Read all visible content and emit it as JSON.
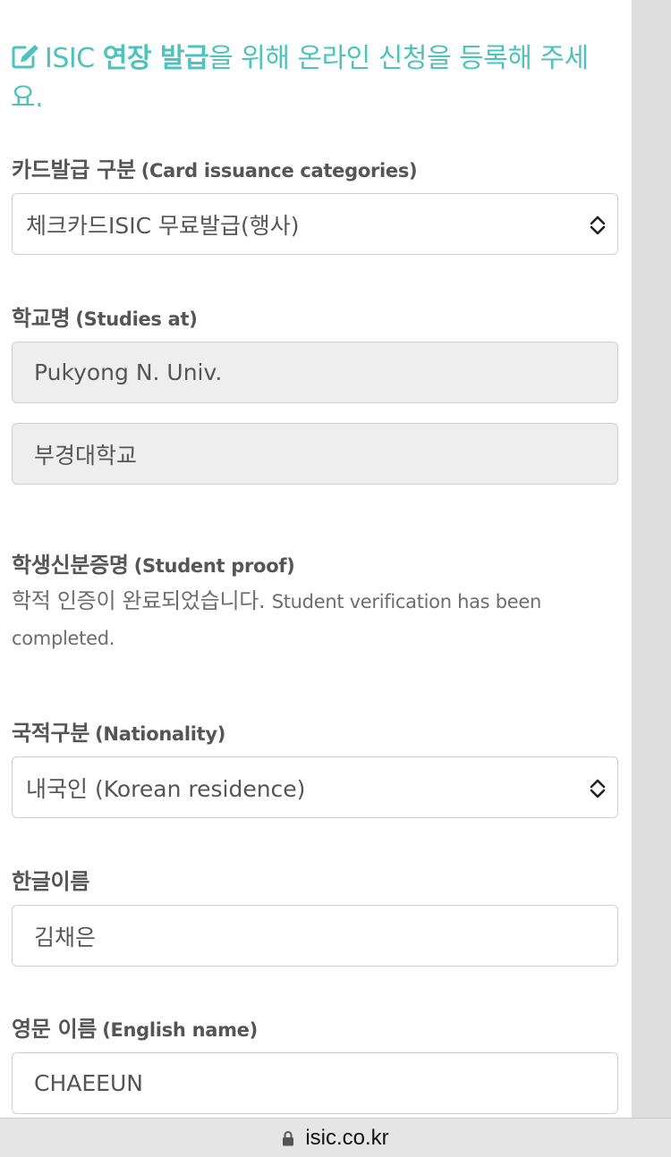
{
  "heading": {
    "prefix": "ISIC ",
    "bold_text": "연장 발급",
    "suffix": "을 위해 온라인 신청을 등록해 주세요.",
    "icon": "edit-icon",
    "color": "#4ec3bd"
  },
  "card_category": {
    "label_ko": "카드발급 구분",
    "label_en": "(Card issuance categories)",
    "selected_value": "체크카드ISIC 무료발급(행사)"
  },
  "school": {
    "label_ko": "학교명",
    "label_en": "(Studies at)",
    "name_en": "Pukyong N. Univ.",
    "name_ko": "부경대학교"
  },
  "student_proof": {
    "label_ko": "학생신분증명",
    "label_en": "(Student proof)",
    "status_ko": "학적 인증이 완료되었습니다.",
    "status_en": "Student verification has been completed."
  },
  "nationality": {
    "label_ko": "국적구분",
    "label_en": "(Nationality)",
    "selected_value": "내국인 (Korean residence)"
  },
  "korean_name": {
    "label_ko": "한글이름",
    "value": "김채은"
  },
  "english_name": {
    "label_ko": "영문 이름",
    "label_en": "(English name)",
    "value": "CHAEEUN"
  },
  "browser": {
    "url": "isic.co.kr",
    "icon": "lock-icon"
  }
}
